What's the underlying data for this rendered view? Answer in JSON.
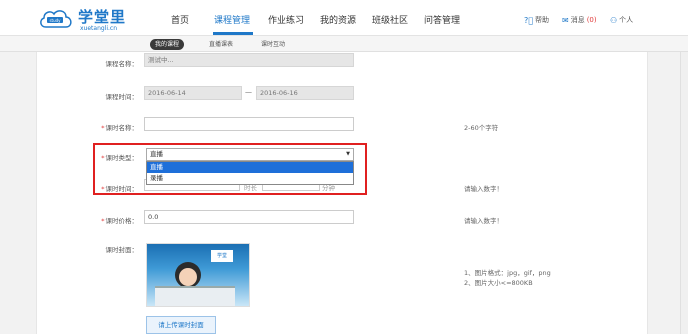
{
  "header": {
    "logo_title": "学堂里",
    "logo_subtitle": "xuetangli.cn",
    "logo_badge": "study",
    "nav": [
      {
        "label": "首页"
      },
      {
        "label": "课程管理"
      },
      {
        "label": "作业练习"
      },
      {
        "label": "我的资源"
      },
      {
        "label": "班级社区"
      },
      {
        "label": "问答管理"
      }
    ],
    "help_label": "帮助",
    "message_label": "消息",
    "message_count": "(0)",
    "user_label": "个人"
  },
  "subnav": {
    "tabs": [
      {
        "label": "我的课程"
      },
      {
        "label": "直播课表"
      },
      {
        "label": "课时互动"
      }
    ]
  },
  "form": {
    "course_name": {
      "label": "课程名称：",
      "value": "测试中..."
    },
    "course_time": {
      "label": "课程时间：",
      "start": "2016-06-14",
      "end": "2016-06-16",
      "separator": "—"
    },
    "lesson_name": {
      "label": "课时名称：",
      "value": "",
      "hint": "2-60个字符"
    },
    "lesson_type": {
      "label": "课时类型：",
      "selected": "直播",
      "options": [
        "直播",
        "录播"
      ]
    },
    "lesson_duration": {
      "label": "课时时间：",
      "unit_hour": "时长",
      "unit_minute": "分钟",
      "hint": "请输入数字！"
    },
    "lesson_price": {
      "label": "课时价格：",
      "value": "0.0",
      "hint": "请输入数字！"
    },
    "lesson_cover": {
      "label": "课时封面：",
      "thumb_badge": "学堂",
      "hint_line1": "1、图片格式：jpg，gif，png",
      "hint_line2": "2、图片大小<=800KB",
      "upload_label": "请上传课时封面"
    }
  }
}
